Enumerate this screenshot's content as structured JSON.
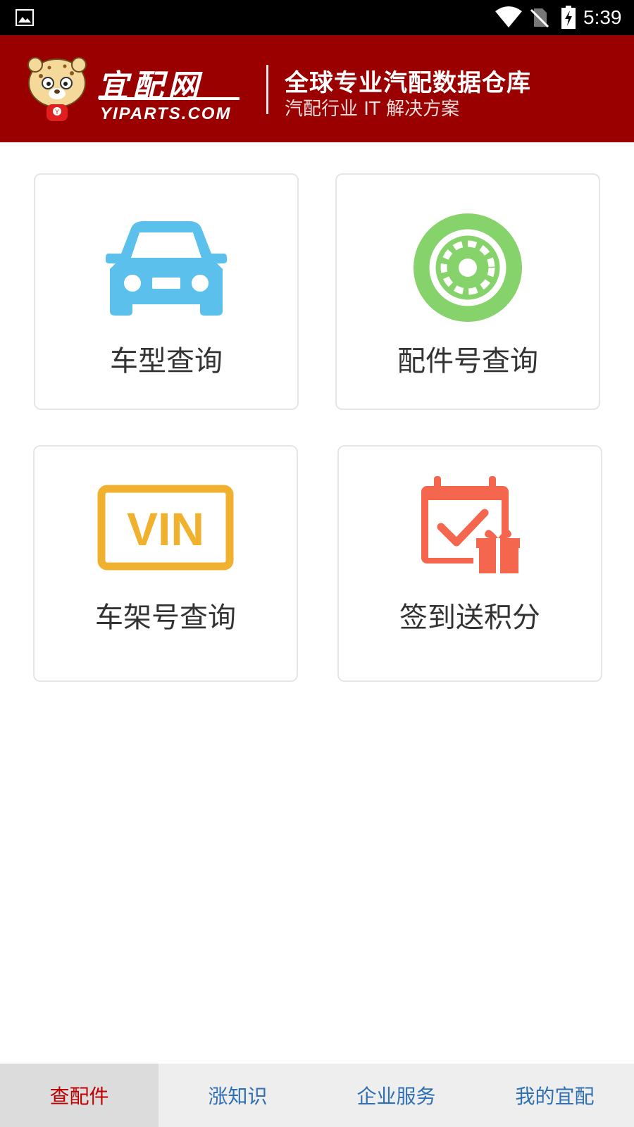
{
  "status_bar": {
    "time": "5:39",
    "icons": [
      "gallery-icon",
      "wifi-icon",
      "no-sim-icon",
      "battery-charging-icon"
    ]
  },
  "header": {
    "logo_cn": "宜配网",
    "logo_en": "YIPARTS.COM",
    "tagline_main": "全球专业汽配数据仓库",
    "tagline_sub": "汽配行业 IT 解决方案"
  },
  "cards": [
    {
      "label": "车型查询",
      "icon": "car-icon",
      "color": "#5bc0eb"
    },
    {
      "label": "配件号查询",
      "icon": "wheel-icon",
      "color": "#86d36b"
    },
    {
      "label": "车架号查询",
      "icon": "vin-icon",
      "icon_text": "VIN",
      "color": "#f0b22e"
    },
    {
      "label": "签到送积分",
      "icon": "calendar-gift-icon",
      "color": "#f4674e"
    }
  ],
  "bottom_nav": {
    "items": [
      {
        "label": "查配件",
        "active": true
      },
      {
        "label": "涨知识",
        "active": false
      },
      {
        "label": "企业服务",
        "active": false
      },
      {
        "label": "我的宜配",
        "active": false
      }
    ],
    "active_color": "#c00000",
    "inactive_color": "#2f6fb3"
  }
}
